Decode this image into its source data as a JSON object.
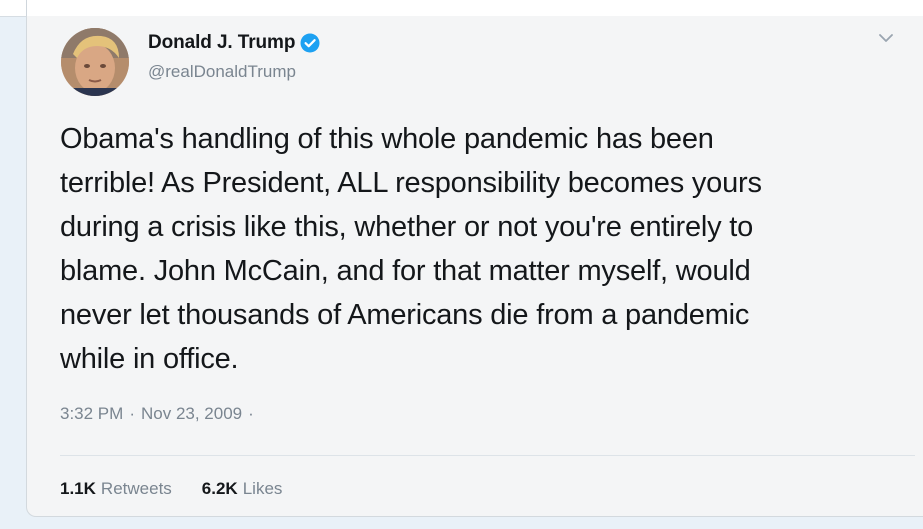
{
  "tweet": {
    "author": {
      "display_name": "Donald J. Trump",
      "handle": "@realDonaldTrump",
      "verified": true,
      "avatar_icon": "profile-photo"
    },
    "lines": [
      "Obama's handling of this whole pandemic has been",
      "terrible! As President, ALL responsibility becomes yours",
      "during a crisis like this, whether or not you're entirely to",
      "blame. John McCain, and for that matter myself, would",
      "never let thousands of Americans die from a pandemic",
      "while in office."
    ],
    "time": "3:32 PM",
    "separator": "·",
    "date": "Nov 23, 2009",
    "trailing_dot": "·",
    "retweets": {
      "count": "1.1K",
      "label": "Retweets"
    },
    "likes": {
      "count": "6.2K",
      "label": "Likes"
    },
    "menu_icon": "chevron-down-icon"
  },
  "colors": {
    "text": "#14171a",
    "secondary_text": "#7a8590",
    "verified_blue": "#1da1f2",
    "card_background": "#f4f5f6",
    "page_background": "#e9f1f8"
  }
}
